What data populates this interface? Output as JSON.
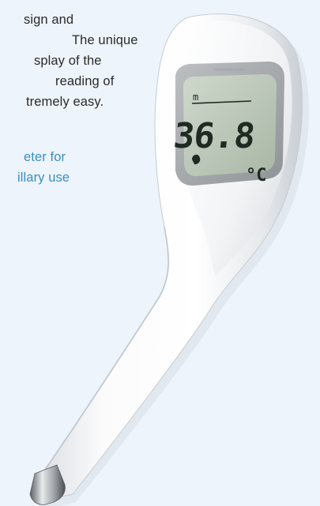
{
  "description": {
    "lines": [
      "sign and",
      "The unique",
      "splay of the",
      "reading of",
      "tremely easy."
    ]
  },
  "tagline": {
    "lines": [
      "eter for",
      "illary use"
    ]
  },
  "device": {
    "display_reading": "36.8",
    "display_unit": "°C",
    "display_mode_mark": "m"
  },
  "colors": {
    "background": "#eef4fb",
    "accent": "#3a8fc0",
    "body_text": "#2a2a2a",
    "lcd": "#b9c6b6"
  }
}
